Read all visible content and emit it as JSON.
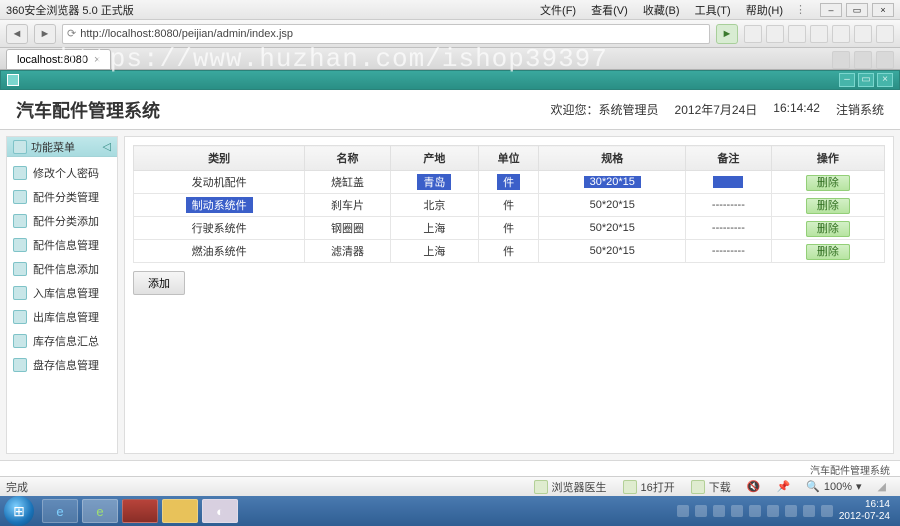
{
  "browser": {
    "title": "360安全浏览器 5.0 正式版",
    "menus": [
      "文件(F)",
      "查看(V)",
      "收藏(B)",
      "工具(T)",
      "帮助(H)"
    ],
    "url": "http://localhost:8080/peijian/admin/index.jsp",
    "tab1": "localhost:8080",
    "status_done": "完成",
    "sb_doctor": "浏览器医生",
    "sb_open": "16打开",
    "sb_download": "下载",
    "sb_zoom": "100%"
  },
  "watermark": "https://www.huzhan.com/ishop39397",
  "header": {
    "title": "汽车配件管理系统",
    "welcome": "欢迎您：系统管理员",
    "date": "2012年7月24日",
    "time": "16:14:42",
    "logout": "注销系统"
  },
  "sidebar": {
    "title": "功能菜单",
    "items": [
      {
        "label": "修改个人密码"
      },
      {
        "label": "配件分类管理"
      },
      {
        "label": "配件分类添加"
      },
      {
        "label": "配件信息管理"
      },
      {
        "label": "配件信息添加"
      },
      {
        "label": "入库信息管理"
      },
      {
        "label": "出库信息管理"
      },
      {
        "label": "库存信息汇总"
      },
      {
        "label": "盘存信息管理"
      }
    ]
  },
  "table": {
    "headers": [
      "类别",
      "名称",
      "产地",
      "单位",
      "规格",
      "备注",
      "操作"
    ],
    "rows": [
      {
        "cat": "发动机配件",
        "name": "烧缸盖",
        "origin": "青岛",
        "unit": "件",
        "spec": "30*20*15",
        "note": "——",
        "op": "删除",
        "hl": true
      },
      {
        "cat": "制动系统件",
        "name": "刹车片",
        "origin": "北京",
        "unit": "件",
        "spec": "50*20*15",
        "note": "---------",
        "op": "删除",
        "hl": false
      },
      {
        "cat": "行驶系统件",
        "name": "钢圈圈",
        "origin": "上海",
        "unit": "件",
        "spec": "50*20*15",
        "note": "---------",
        "op": "删除",
        "hl": false
      },
      {
        "cat": "燃油系统件",
        "name": "滤清器",
        "origin": "上海",
        "unit": "件",
        "spec": "50*20*15",
        "note": "---------",
        "op": "删除",
        "hl": false
      }
    ],
    "add": "添加"
  },
  "footer_app": "汽车配件管理系统",
  "taskbar": {
    "time": "16:14",
    "date": "2012-07-24"
  }
}
